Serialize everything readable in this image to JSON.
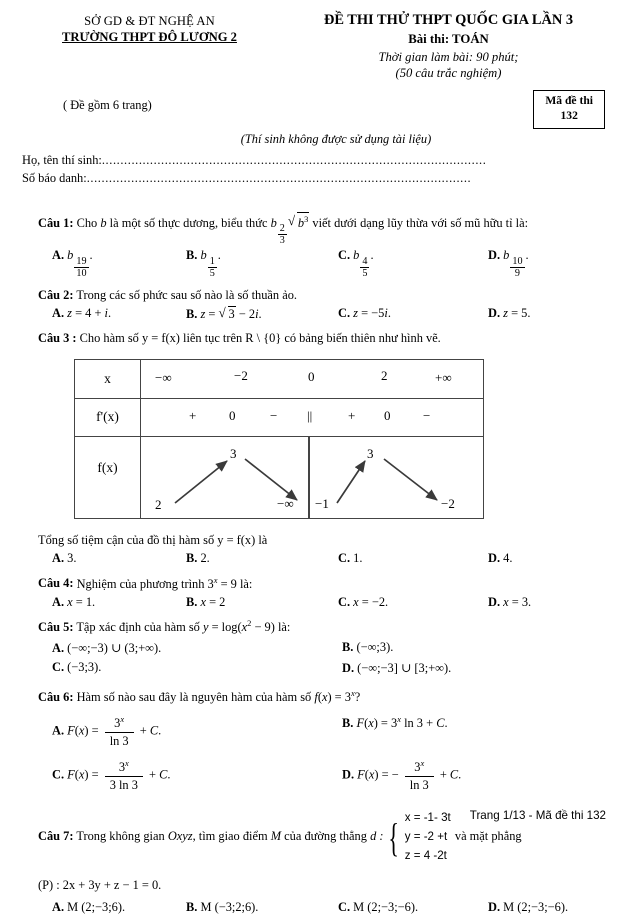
{
  "header": {
    "dept_line1": "SỞ GD & ĐT NGHỆ AN",
    "dept_line2": "TRƯỜNG THPT ĐÔ LƯƠNG 2",
    "title": "ĐỀ THI THỬ THPT QUỐC GIA LẦN 3",
    "subject": "Bài thi: TOÁN",
    "duration": "Thời gian làm bài: 90 phút;",
    "count": "(50 câu trắc nghiệm)",
    "pages_note": "( Đề gồm 6 trang)",
    "code_label": "Mã đề thi",
    "code_value": "132",
    "no_documents": "(Thí sinh không được sử dụng tài liệu)",
    "name_label": "Họ, tên thí sinh:",
    "id_label": "Số báo danh:",
    "dots": "........................................................................................................"
  },
  "questions": [
    {
      "label": "Câu 1:",
      "text_before": "Cho",
      "var": "b",
      "text_mid": "là một số thực dương, biểu thức",
      "expr": "b^(2/3)·√(b^3)",
      "text_after": "viết dưới dạng lũy thừa với số mũ hữu tỉ là:",
      "options": [
        {
          "key": "A.",
          "value": "b^(19/10)."
        },
        {
          "key": "B.",
          "value": "b^(1/5)."
        },
        {
          "key": "C.",
          "value": "b^(4/5)."
        },
        {
          "key": "D.",
          "value": "b^(10/9)."
        }
      ]
    },
    {
      "label": "Câu 2:",
      "text": "Trong  các số phức sau số nào là số thuần ảo.",
      "options": [
        {
          "key": "A.",
          "value": "z = 4 + i."
        },
        {
          "key": "B.",
          "value": "z = √3 − 2i."
        },
        {
          "key": "C.",
          "value": "z = −5i."
        },
        {
          "key": "D.",
          "value": "z = 5."
        }
      ]
    },
    {
      "label": "Câu 3 :",
      "text": "Cho hàm số y = f(x) liên tục trên R \\ {0} có bảng biến thiên như hình vẽ.",
      "prompt": "Tổng số tiệm cận của đồ thị hàm số y = f(x) là",
      "options": [
        {
          "key": "A.",
          "value": "3."
        },
        {
          "key": "B.",
          "value": "2."
        },
        {
          "key": "C.",
          "value": "1."
        },
        {
          "key": "D.",
          "value": "4."
        }
      ]
    },
    {
      "label": "Câu 4:",
      "text": "Nghiệm của phương trình 3^x = 9  là:",
      "options": [
        {
          "key": "A.",
          "value": "x = 1."
        },
        {
          "key": "B.",
          "value": "x = 2"
        },
        {
          "key": "C.",
          "value": "x = −2."
        },
        {
          "key": "D.",
          "value": "x = 3."
        }
      ]
    },
    {
      "label": "Câu 5:",
      "text": "Tập xác định của hàm số y = log(x² − 9) là:",
      "options": [
        {
          "key": "A.",
          "value": "(−∞;−3) ∪ (3;+∞)."
        },
        {
          "key": "B.",
          "value": "(−∞;3)."
        },
        {
          "key": "C.",
          "value": "(−3;3)."
        },
        {
          "key": "D.",
          "value": "(−∞;−3] ∪ [3;+∞)."
        }
      ]
    },
    {
      "label": "Câu 6:",
      "text": "Hàm số nào sau đây là nguyên hàm của hàm số f(x) = 3^x ?",
      "options": [
        {
          "key": "A.",
          "value": "F(x) = 3^x/ln3 + C."
        },
        {
          "key": "B.",
          "value": "F(x) = 3^x ln3 + C."
        },
        {
          "key": "C.",
          "value": "F(x) = 3^x/(3 ln3) + C."
        },
        {
          "key": "D.",
          "value": "F(x) = − 3^x/ln3 + C."
        }
      ]
    },
    {
      "label": "Câu 7:",
      "text_a": "Trong không gian",
      "space": "Oxyz",
      "text_b": ", tìm giao điểm",
      "point": "M",
      "text_c": "của đường thẳng",
      "line": "d :",
      "system": [
        "x = -1- 3t",
        "y = -2 +t",
        "z = 4 -2t"
      ],
      "text_d": "và mặt phẳng",
      "plane": "(P) : 2x + 3y + z − 1 = 0.",
      "options": [
        {
          "key": "A.",
          "value": "M (2;−3;6)."
        },
        {
          "key": "B.",
          "value": "M (−3;2;6)."
        },
        {
          "key": "C.",
          "value": "M (2;−3;−6)."
        },
        {
          "key": "D.",
          "value": "M (2;−3;−6)."
        }
      ]
    }
  ],
  "variation_table": {
    "row_labels": [
      "x",
      "f'(x)",
      "f(x)"
    ],
    "x_values": [
      "−∞",
      "−2",
      "0",
      "2",
      "+∞"
    ],
    "fprime_signs": [
      "+",
      "0",
      "−",
      "||",
      "+",
      "0",
      "−"
    ],
    "f_values_left": [
      "2",
      "3",
      "−∞"
    ],
    "f_values_right": [
      "−1",
      "3",
      "−2"
    ]
  },
  "footer": "Trang 1/13 - Mã đề thi 132"
}
